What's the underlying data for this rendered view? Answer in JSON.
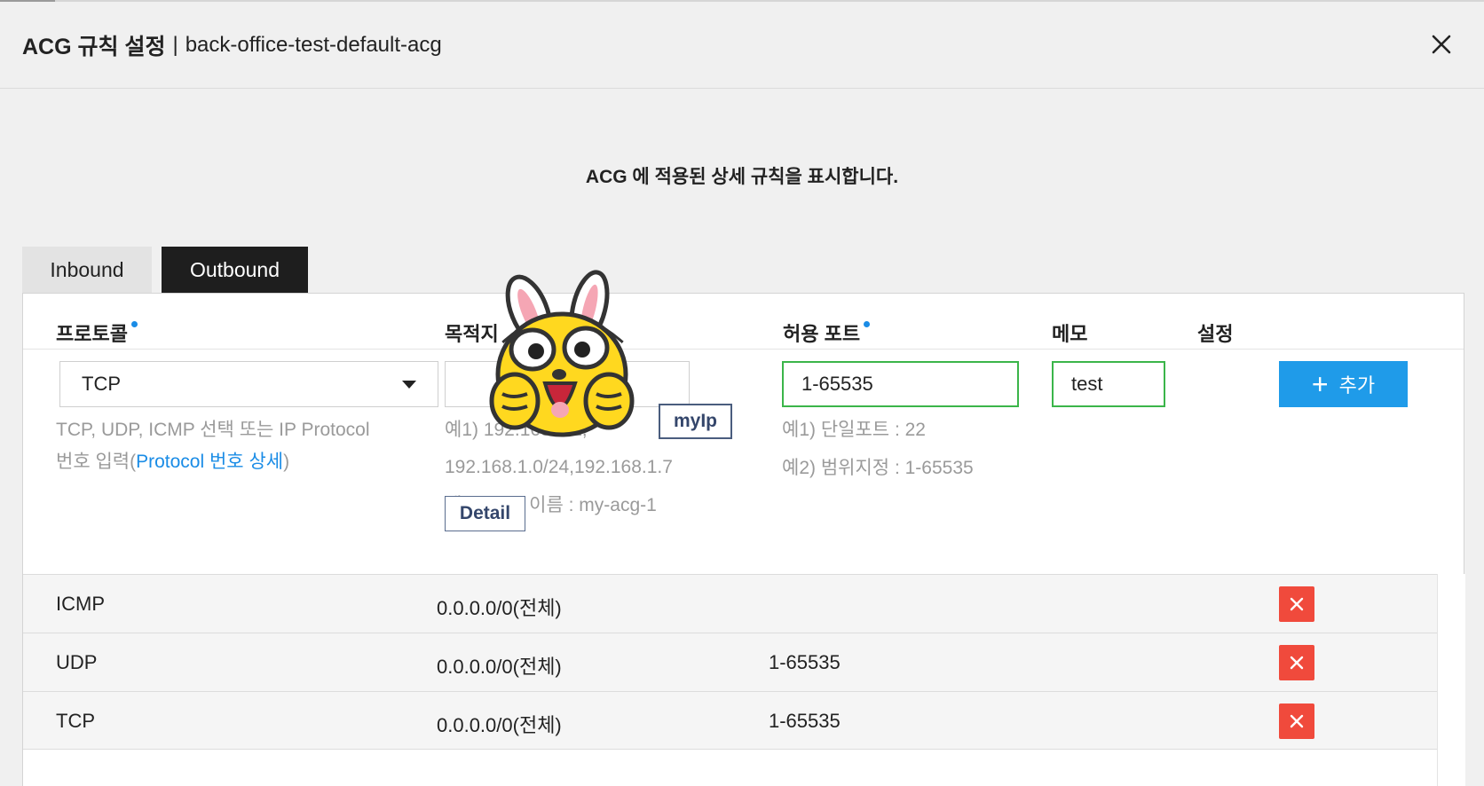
{
  "header": {
    "title": "ACG 규칙 설정",
    "separator": "|",
    "subtitle": "back-office-test-default-acg",
    "close_icon": "close-icon"
  },
  "description": "ACG 에 적용된 상세 규칙을 표시합니다.",
  "tabs": [
    {
      "label": "Inbound",
      "active": false
    },
    {
      "label": "Outbound",
      "active": true
    }
  ],
  "columns": {
    "protocol": "프로토콜",
    "destination": "목적지",
    "port": "허용 포트",
    "memo": "메모",
    "settings": "설정"
  },
  "form": {
    "protocol_value": "TCP",
    "protocol_hint_line1": "TCP, UDP, ICMP 선택 또는 IP Protocol",
    "protocol_hint_line2_prefix": "번호 입력(",
    "protocol_hint_link": "Protocol 번호 상세",
    "protocol_hint_line2_suffix": ")",
    "destination_value": "",
    "destination_hint_line1": "예1) 192.168.1.1,",
    "destination_hint_line2": "192.168.1.0/24,192.168.1.7",
    "destination_hint_line3": "예2) ACG 이름 : my-acg-1",
    "myip_label": "myIp",
    "detail_label": "Detail",
    "port_value": "1-65535",
    "port_hint_line1": "예1) 단일포트 : 22",
    "port_hint_line2": "예2) 범위지정 : 1-65535",
    "memo_value": "test",
    "add_label": "추가"
  },
  "rules": [
    {
      "protocol": "ICMP",
      "destination": "0.0.0.0/0(전체)",
      "port": ""
    },
    {
      "protocol": "UDP",
      "destination": "0.0.0.0/0(전체)",
      "port": "1-65535"
    },
    {
      "protocol": "TCP",
      "destination": "0.0.0.0/0(전체)",
      "port": "1-65535"
    }
  ],
  "colors": {
    "accent": "#1f9be9",
    "focus_border": "#3bb54a",
    "delete": "#f04a3c",
    "active_tab": "#1e1e1e"
  }
}
